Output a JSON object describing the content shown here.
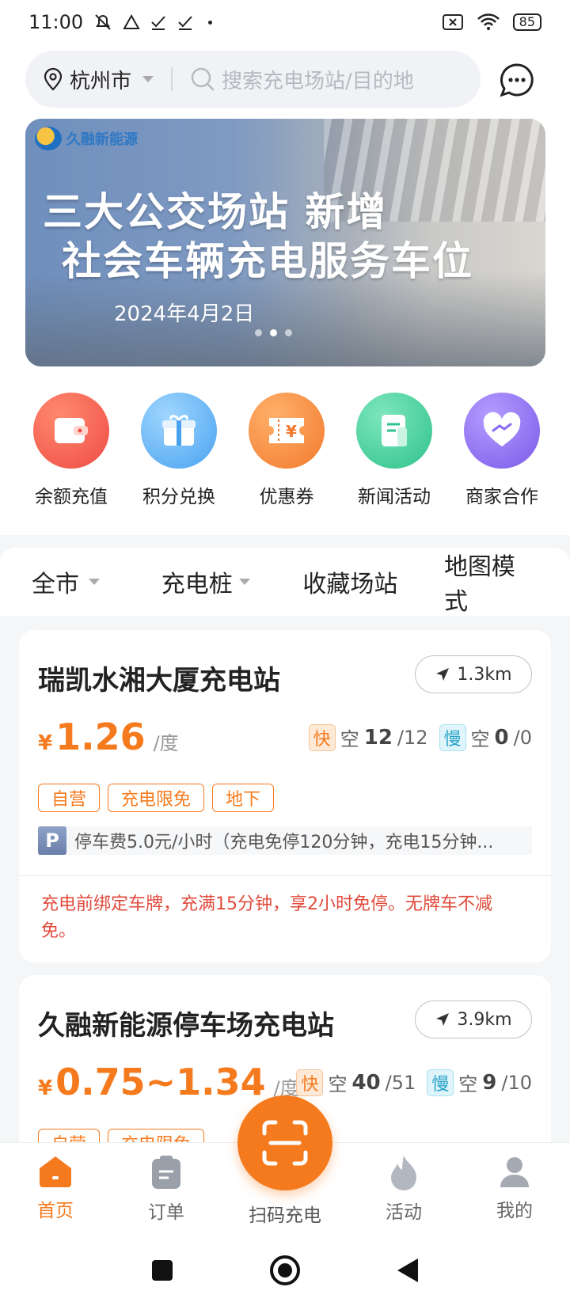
{
  "status_bar": {
    "time": "11:00",
    "icons": [
      "mute-bell-icon",
      "triangle-icon",
      "check-icon",
      "check-icon",
      "dot-icon"
    ],
    "right_icons": [
      "sim-x-icon",
      "wifi-icon",
      "battery-icon"
    ],
    "battery": "85"
  },
  "search": {
    "city": "杭州市",
    "placeholder": "搜索充电场站/目的地"
  },
  "banner": {
    "brand": "久融新能源",
    "line1": "三大公交场站 新增",
    "line2": "社会车辆充电服务车位",
    "date": "2024年4月2日",
    "page_count": 3,
    "active_index": 1
  },
  "quick_actions": [
    {
      "label": "余额充值",
      "icon": "wallet-icon",
      "color": "#f0594f"
    },
    {
      "label": "积分兑换",
      "icon": "gift-icon",
      "color": "#5aaef0"
    },
    {
      "label": "优惠券",
      "icon": "coupon-icon",
      "color": "#f7883a"
    },
    {
      "label": "新闻活动",
      "icon": "news-icon",
      "color": "#3ec99a"
    },
    {
      "label": "商家合作",
      "icon": "handshake-heart-icon",
      "color": "#8a6cf0"
    }
  ],
  "filters": {
    "area": "全市",
    "type": "充电桩",
    "favorites": "收藏场站",
    "map": "地图模式"
  },
  "stations": [
    {
      "name": "瑞凯水湘大厦充电站",
      "distance": "1.3km",
      "currency": "¥",
      "price": "1.26",
      "unit": "/度",
      "fast_label": "快",
      "fast_free_label": "空",
      "fast_free": "12",
      "fast_total": "/12",
      "slow_label": "慢",
      "slow_free_label": "空",
      "slow_free": "0",
      "slow_total": "/0",
      "tags": [
        "自营",
        "充电限免",
        "地下"
      ],
      "parking_badge": "P",
      "parking": "停车费5.0元/小时（充电免停120分钟，充电15分钟...",
      "notice": "充电前绑定车牌，充满15分钟，享2小时免停。无牌车不减免。"
    },
    {
      "name": "久融新能源停车场充电站",
      "distance": "3.9km",
      "currency": "¥",
      "price": "0.75~1.34",
      "unit": "/度",
      "fast_label": "快",
      "fast_free_label": "空",
      "fast_free": "40",
      "fast_total": "/51",
      "slow_label": "慢",
      "slow_free_label": "空",
      "slow_free": "9",
      "slow_total": "/10",
      "tags": [
        "自营",
        "充电限免"
      ]
    }
  ],
  "bottom_nav": {
    "home": "首页",
    "orders": "订单",
    "scan": "扫码充电",
    "activity": "活动",
    "mine": "我的"
  }
}
